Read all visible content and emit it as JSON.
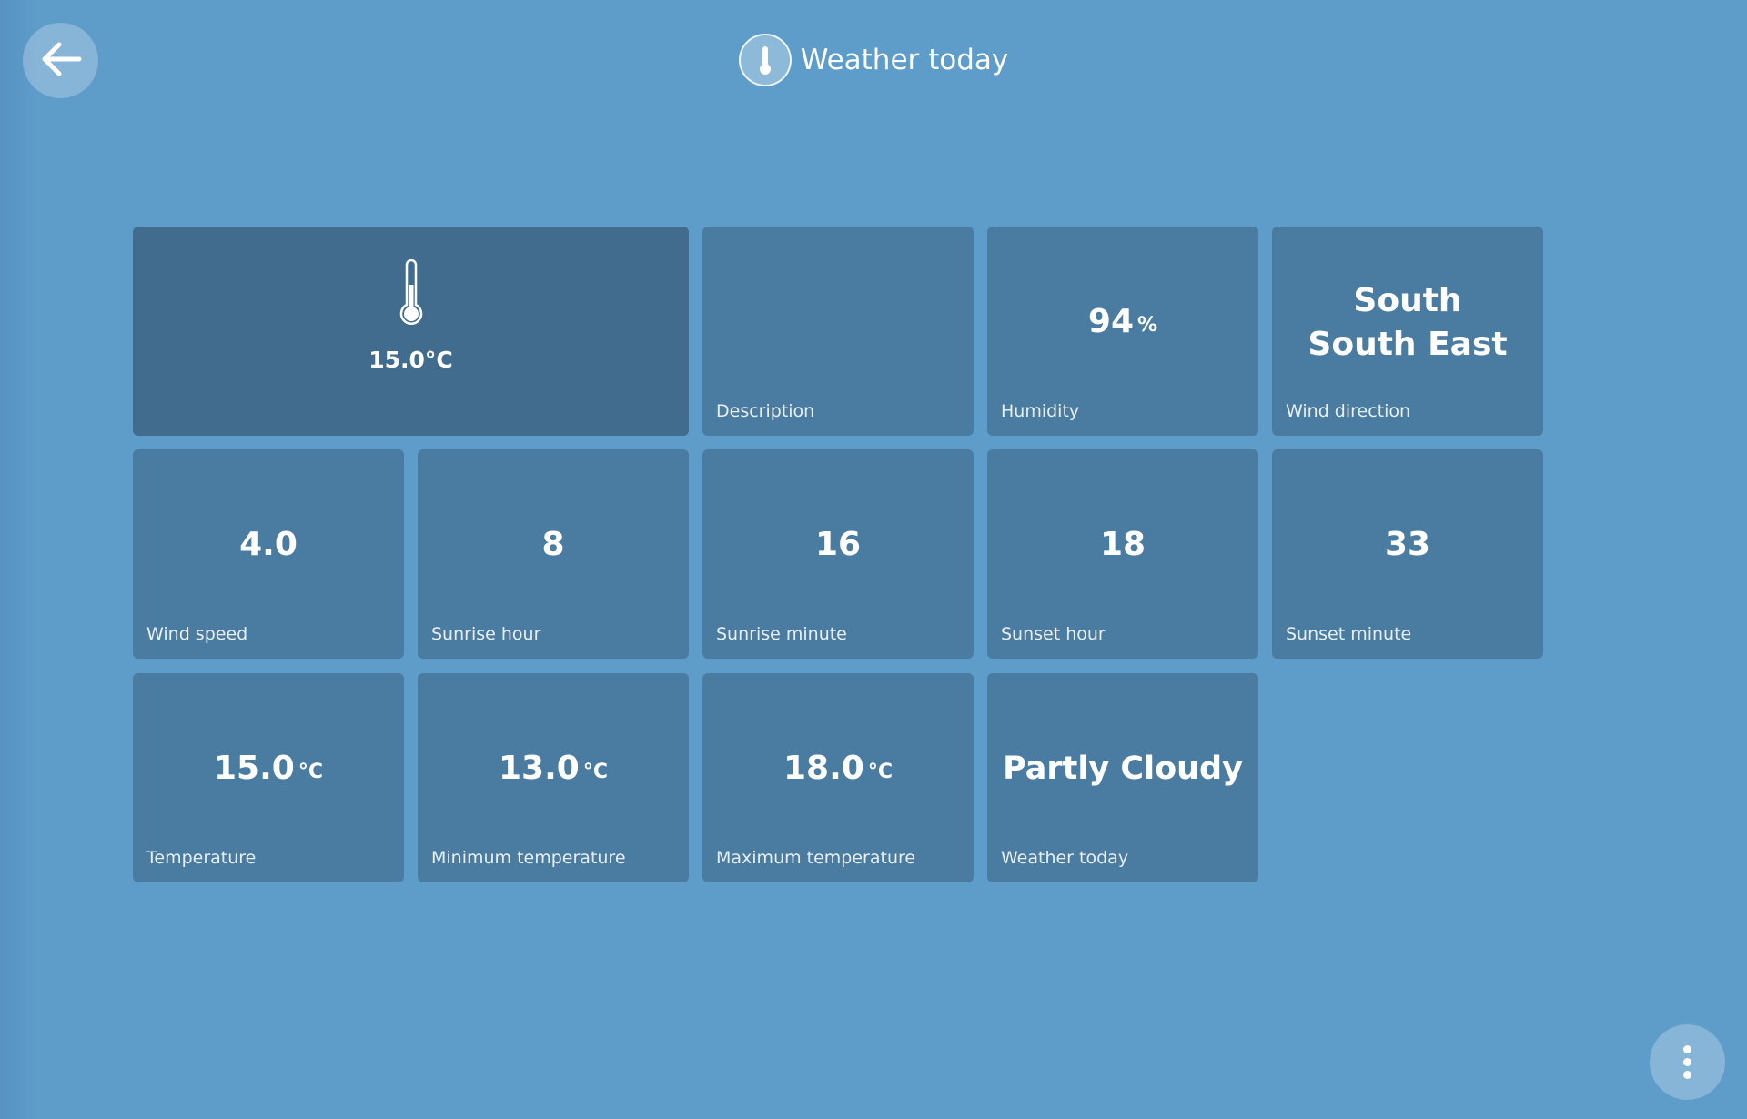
{
  "header": {
    "title": "Weather today",
    "icon": "thermometer-icon"
  },
  "navigation": {
    "back_icon": "arrow-left-icon",
    "menu_icon": "more-vertical-icon"
  },
  "featured": {
    "icon": "thermometer-icon",
    "temperature": "15.0°C"
  },
  "tiles": {
    "description": {
      "value": "",
      "label": "Description"
    },
    "humidity": {
      "value": "94",
      "unit": "%",
      "label": "Humidity"
    },
    "wind_direction": {
      "value": "South South East",
      "label": "Wind direction"
    },
    "wind_speed": {
      "value": "4.0",
      "label": "Wind speed"
    },
    "sunrise_hour": {
      "value": "8",
      "label": "Sunrise hour"
    },
    "sunrise_minute": {
      "value": "16",
      "label": "Sunrise minute"
    },
    "sunset_hour": {
      "value": "18",
      "label": "Sunset hour"
    },
    "sunset_minute": {
      "value": "33",
      "label": "Sunset minute"
    },
    "temperature": {
      "value": "15.0",
      "unit": "°C",
      "label": "Temperature"
    },
    "min_temperature": {
      "value": "13.0",
      "unit": "°C",
      "label": "Minimum temperature"
    },
    "max_temperature": {
      "value": "18.0",
      "unit": "°C",
      "label": "Maximum temperature"
    },
    "weather_today": {
      "value": "Partly Cloudy",
      "label": "Weather today"
    }
  },
  "colors": {
    "background": "#5e9cca",
    "tile": "#4a7ca1",
    "featured_tile": "#426c8d"
  }
}
